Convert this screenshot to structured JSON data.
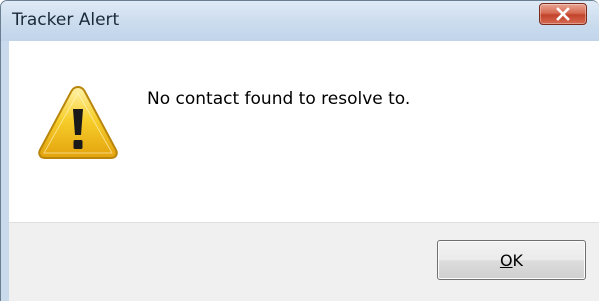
{
  "window": {
    "title": "Tracker Alert",
    "close_icon": "close-icon"
  },
  "dialog": {
    "icon": "warning-icon",
    "message": "No contact found to resolve to."
  },
  "buttons": {
    "ok_accel": "O",
    "ok_rest": "K"
  },
  "colors": {
    "titlebar": "#c9daec",
    "close_button": "#c2442a",
    "warning_yellow": "#f5c518",
    "footer": "#f0f0f0"
  }
}
